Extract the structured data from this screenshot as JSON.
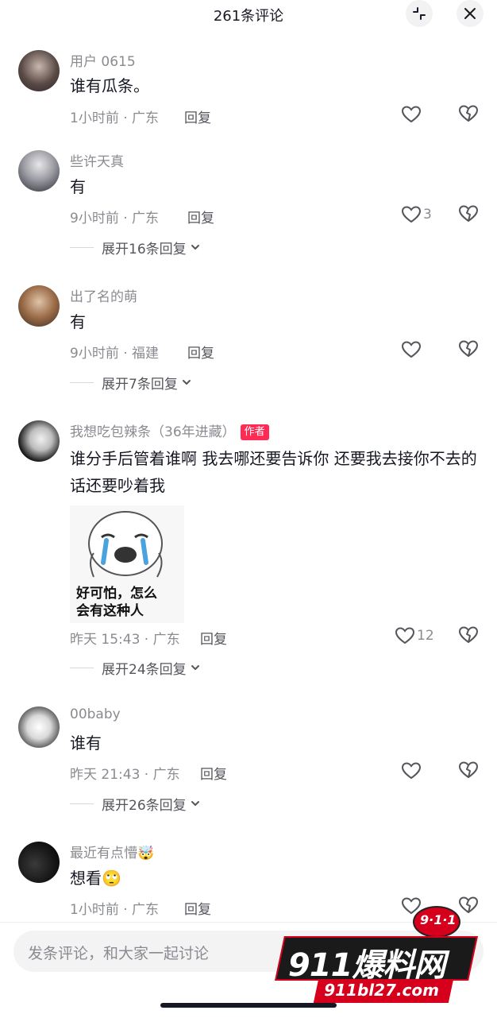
{
  "header": {
    "title": "261条评论"
  },
  "comments": [
    {
      "username": "用户 0615",
      "text": "谁有瓜条。",
      "time": "1小时前",
      "location": "广东",
      "reply": "回复",
      "likes": "",
      "expand": ""
    },
    {
      "username": "些许天真",
      "text": "有",
      "time": "9小时前",
      "location": "广东",
      "reply": "回复",
      "likes": "3",
      "expand": "展开16条回复"
    },
    {
      "username": "出了名的萌",
      "text": "有",
      "time": "9小时前",
      "location": "福建",
      "reply": "回复",
      "likes": "",
      "expand": "展开7条回复"
    },
    {
      "username": "我想吃包辣条（36年进藏）",
      "author_tag": "作者",
      "text": "谁分手后管着谁啊 我去哪还要告诉你 还要我去接你不去的话还要吵着我",
      "sticker_text": "好可怕，怎么\n会有这种人",
      "time": "昨天 15:43",
      "location": "广东",
      "reply": "回复",
      "likes": "12",
      "expand": "展开24条回复"
    },
    {
      "username": "00baby",
      "text": "谁有",
      "time": "昨天 21:43",
      "location": "广东",
      "reply": "回复",
      "likes": "",
      "expand": "展开26条回复"
    },
    {
      "username": "最近有点懵🤯",
      "text": "想看🙄",
      "time": "1小时前",
      "location": "广东",
      "reply": "回复",
      "likes": "",
      "expand": ""
    }
  ],
  "input": {
    "placeholder": "发条评论，和大家一起讨论"
  },
  "watermark": {
    "badge": "9·1·1",
    "brand": "911爆料网",
    "url": "911bl27.com"
  },
  "colors": {
    "author_tag": "#fe2c55",
    "secondary_text": "#8a8b91",
    "primary_text": "#161823"
  }
}
